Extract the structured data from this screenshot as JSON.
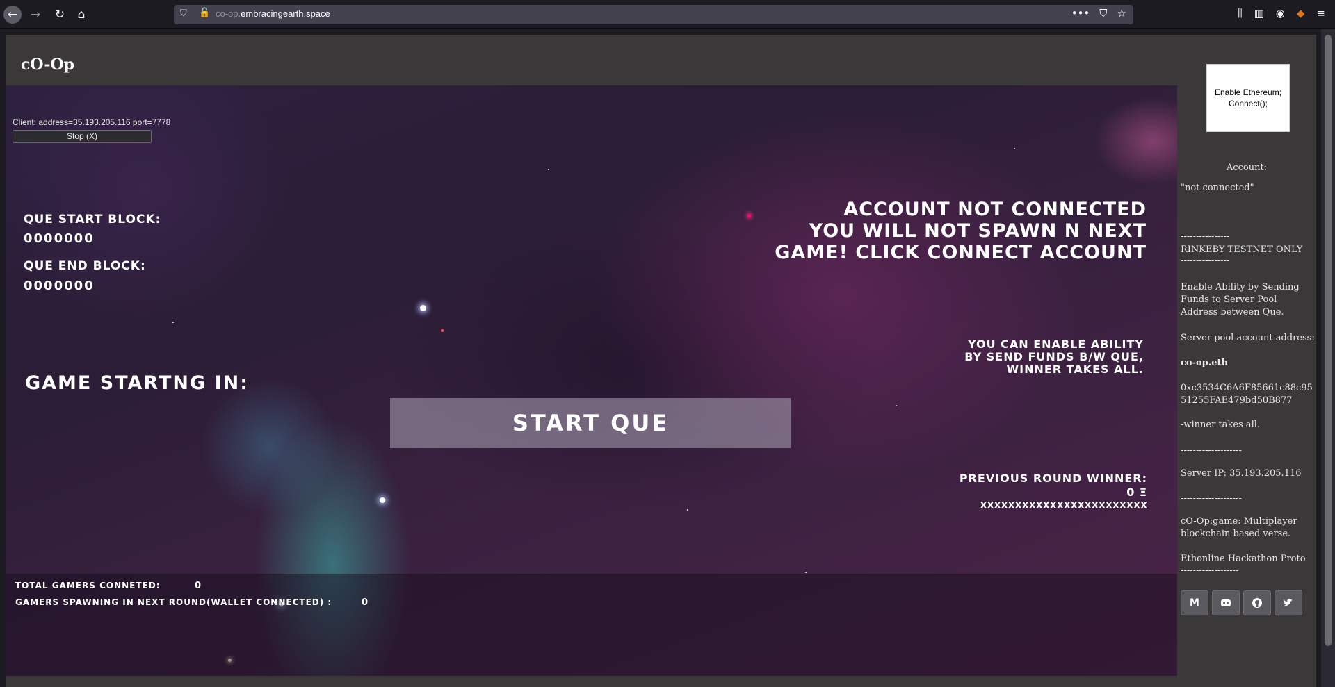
{
  "browser": {
    "url_prefix": "co-op.",
    "url_domain": "embracingearth.space",
    "nav_icons": [
      "back-icon",
      "forward-icon",
      "reload-icon",
      "home-icon"
    ],
    "tool_icons": [
      "library-icon",
      "sidebar-icon",
      "account-icon",
      "metamask-icon",
      "menu-icon"
    ]
  },
  "site": {
    "title": "cO-Op"
  },
  "game": {
    "client_info": "Client: address=35.193.205.116 port=7778",
    "stop_label": "Stop (X)",
    "que_start_label": "QUE START BLOCK:",
    "que_start_value": "0000000",
    "que_end_label": "QUE END BLOCK:",
    "que_end_value": "0000000",
    "game_starting_label": "GAME STARTNG IN:",
    "warning_lines": [
      "ACCOUNT NOT CONNECTED",
      "YOU WILL NOT SPAWN N NEXT",
      "GAME! CLICK CONNECT ACCOUNT"
    ],
    "ability_lines": [
      "YOU CAN ENABLE ABILITY",
      "BY SEND FUNDS B/W QUE,",
      "WINNER TAKES ALL."
    ],
    "start_que_label": "START QUE",
    "prev_winner_label": "PREVIOUS ROUND WINNER:",
    "prev_winner_amount": "0 Ξ",
    "prev_winner_address": "XXXXXXXXXXXXXXXXXXXXXXXX",
    "total_gamers_label": "TOTAL GAMERS CONNETED:",
    "total_gamers_value": "0",
    "spawning_label": "GAMERS SPAWNING IN NEXT ROUND(WALLET CONNECTED) :",
    "spawning_value": "0"
  },
  "sidebar": {
    "eth_button_line1": "Enable Ethereum;",
    "eth_button_line2": "Connect();",
    "account_label": "Account:",
    "account_value": "\"not connected\"",
    "divider_short": "----------------",
    "network_note": "RINKEBY TESTNET ONLY",
    "ability_note": "Enable Ability by Sending Funds to Server Pool Address between Que.",
    "pool_label": "Server pool account address:",
    "pool_ens": "co-op.eth",
    "pool_address": "0xc3534C6A6F85661c88c9551255FAE479bd50B877",
    "winner_note": "-winner takes all.",
    "divider_long": "--------------------",
    "server_ip": "Server IP: 35.193.205.116",
    "about": "cO-Op:game: Multiplayer blockchain based verse.",
    "hackathon": "Ethonline Hackathon Proto",
    "divider_tail": "-------------------",
    "social": [
      {
        "icon": "medium-icon",
        "label": "M"
      },
      {
        "icon": "discord-icon",
        "label": ""
      },
      {
        "icon": "github-icon",
        "label": ""
      },
      {
        "icon": "twitter-icon",
        "label": ""
      }
    ]
  }
}
